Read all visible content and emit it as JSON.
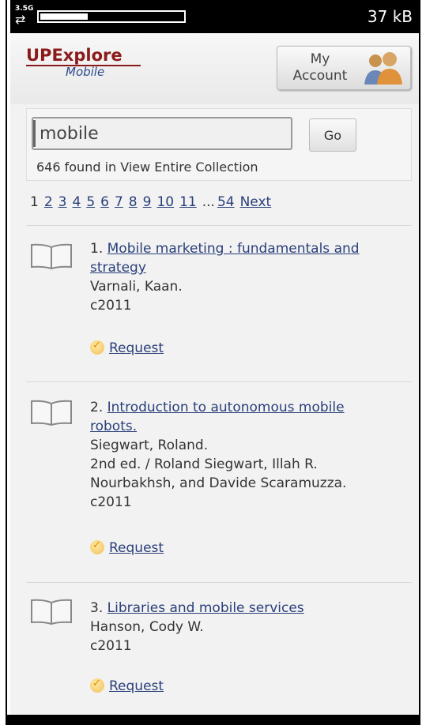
{
  "status": {
    "network": "3.5G",
    "data_used": "37 kB"
  },
  "header": {
    "logo_title": "UPExplore",
    "logo_subtitle": "Mobile",
    "account_line1": "My",
    "account_line2": "Account"
  },
  "search": {
    "query": "mobile",
    "go_label": "Go",
    "found_text": "646 found in View Entire Collection"
  },
  "pagination": {
    "current": "1",
    "pages": [
      "2",
      "3",
      "4",
      "5",
      "6",
      "7",
      "8",
      "9",
      "10",
      "11"
    ],
    "ellipsis": "...",
    "last": "54",
    "next": "Next"
  },
  "results": [
    {
      "number": "1.",
      "title": "Mobile marketing : fundamentals and strategy",
      "author": "Varnali, Kaan.",
      "extra": "",
      "year": "c2011",
      "request": "Request"
    },
    {
      "number": "2.",
      "title": "Introduction to autonomous mobile robots.",
      "author": "Siegwart, Roland.",
      "extra": "2nd ed. / Roland Siegwart, Illah R. Nourbakhsh, and Davide Scaramuzza.",
      "year": "c2011",
      "request": "Request"
    },
    {
      "number": "3.",
      "title": "Libraries and mobile services",
      "author": "Hanson, Cody W.",
      "extra": "",
      "year": "c2011",
      "request": "Request"
    }
  ]
}
